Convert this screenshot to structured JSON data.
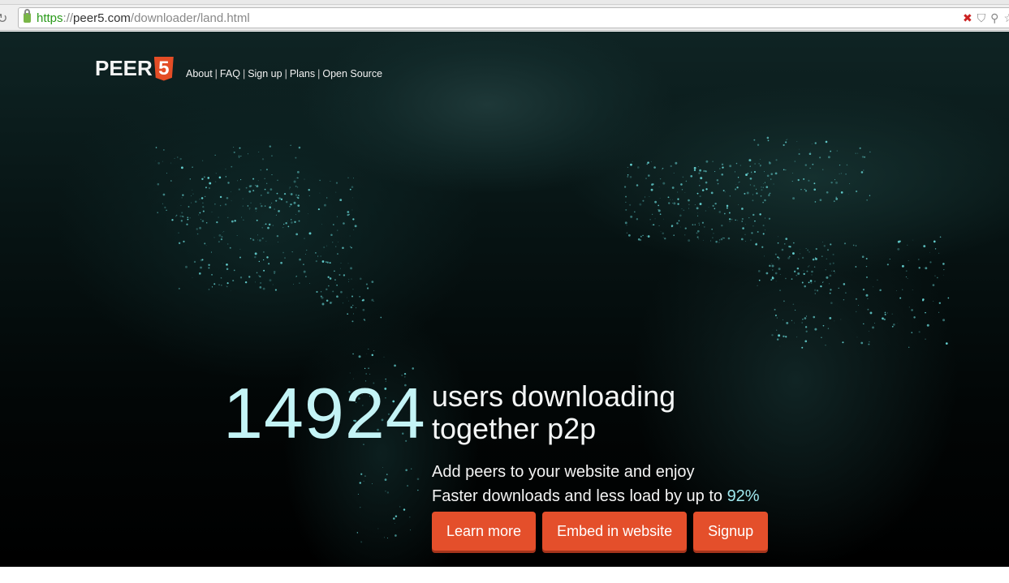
{
  "browser": {
    "url_scheme": "https",
    "url_sep": "://",
    "url_host": "peer5.com",
    "url_path": "/downloader/land.html"
  },
  "logo": {
    "text": "PEER",
    "badge": "5"
  },
  "nav": [
    {
      "label": "About"
    },
    {
      "label": "FAQ"
    },
    {
      "label": "Sign up"
    },
    {
      "label": "Plans"
    },
    {
      "label": "Open Source"
    }
  ],
  "nav_separator": "|",
  "hero": {
    "count": "14924",
    "headline_line1": "users downloading",
    "headline_line2": "together p2p",
    "tagline1": "Add peers to your website and enjoy",
    "tagline2_prefix": "Faster downloads and less load by up to ",
    "tagline2_highlight": "92%"
  },
  "buttons": {
    "learn_more": "Learn more",
    "embed": "Embed in website",
    "signup": "Signup"
  },
  "colors": {
    "accent": "#e44f2b",
    "counter": "#c4f4f6",
    "lights": "#6fe6e6"
  }
}
